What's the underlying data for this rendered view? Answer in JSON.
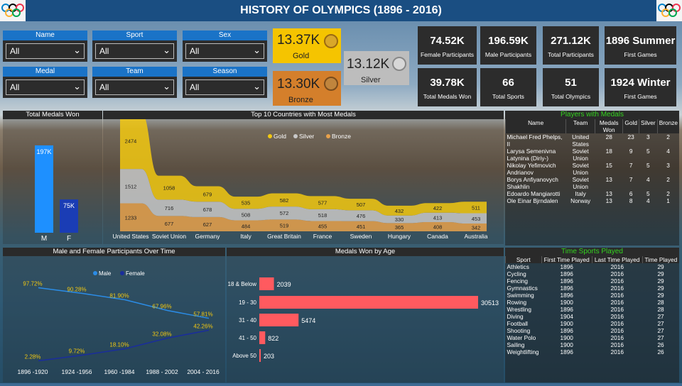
{
  "title": "HISTORY OF OLYMPICS  (1896 - 2016)",
  "slicers": [
    {
      "label": "Name",
      "value": "All"
    },
    {
      "label": "Sport",
      "value": "All"
    },
    {
      "label": "Sex",
      "value": "All"
    },
    {
      "label": "Medal",
      "value": "All"
    },
    {
      "label": "Team",
      "value": "All"
    },
    {
      "label": "Season",
      "value": "All"
    }
  ],
  "medals": {
    "gold_value": "13.37K",
    "gold_label": "Gold",
    "silver_value": "13.12K",
    "silver_label": "Silver",
    "bronze_value": "13.30K",
    "bronze_label": "Bronze"
  },
  "cards": [
    {
      "value": "74.52K",
      "label": "Female Participants"
    },
    {
      "value": "196.59K",
      "label": "Male Participants"
    },
    {
      "value": "271.12K",
      "label": "Total Participants"
    },
    {
      "value": "1896 Summer",
      "label": "First Games"
    },
    {
      "value": "39.78K",
      "label": "Total Medals Won"
    },
    {
      "value": "66",
      "label": "Total Sports"
    },
    {
      "value": "51",
      "label": "Total Olympics"
    },
    {
      "value": "1924 Winter",
      "label": "First Games"
    }
  ],
  "total_medals": {
    "title": "Total Medals Won"
  },
  "top10": {
    "title": "Top 10 Countries with Most Medals",
    "legend": [
      "Gold",
      "Silver",
      "Bronze"
    ]
  },
  "participants": {
    "title": "Male and Female Participants Over Time",
    "legend": [
      "Male",
      "Female"
    ]
  },
  "by_age": {
    "title": "Medals Won by Age"
  },
  "players": {
    "title": "Players with Medals",
    "headers": [
      "Name",
      "Team",
      "Medals Won",
      "Gold",
      "Silver",
      "Bronze"
    ],
    "rows": [
      [
        "Michael Fred Phelps, II",
        "United States",
        "28",
        "23",
        "3",
        "2"
      ],
      [
        "Larysa Semenivna Latynina (Diriy-)",
        "Soviet Union",
        "18",
        "9",
        "5",
        "4"
      ],
      [
        "Nikolay Yefimovich Andrianov",
        "Soviet Union",
        "15",
        "7",
        "5",
        "3"
      ],
      [
        "Borys Anfiyanovych Shakhlin",
        "Soviet Union",
        "13",
        "7",
        "4",
        "2"
      ],
      [
        "Edoardo Mangiarotti",
        "Italy",
        "13",
        "6",
        "5",
        "2"
      ],
      [
        "Ole Einar Bjrndalen",
        "Norway",
        "13",
        "8",
        "4",
        "1"
      ]
    ]
  },
  "sports": {
    "title": "Time Sports Played",
    "headers": [
      "Sport",
      "First Time Played",
      "Last Time Played",
      "Time Played"
    ],
    "rows": [
      [
        "Athletics",
        "1896",
        "2016",
        "29"
      ],
      [
        "Cycling",
        "1896",
        "2016",
        "29"
      ],
      [
        "Fencing",
        "1896",
        "2016",
        "29"
      ],
      [
        "Gymnastics",
        "1896",
        "2016",
        "29"
      ],
      [
        "Swimming",
        "1896",
        "2016",
        "29"
      ],
      [
        "Rowing",
        "1900",
        "2016",
        "28"
      ],
      [
        "Wrestling",
        "1896",
        "2016",
        "28"
      ],
      [
        "Diving",
        "1904",
        "2016",
        "27"
      ],
      [
        "Football",
        "1900",
        "2016",
        "27"
      ],
      [
        "Shooting",
        "1896",
        "2016",
        "27"
      ],
      [
        "Water Polo",
        "1900",
        "2016",
        "27"
      ],
      [
        "Sailing",
        "1900",
        "2016",
        "26"
      ],
      [
        "Weightlifting",
        "1896",
        "2016",
        "26"
      ]
    ]
  },
  "chart_data": [
    {
      "type": "bar",
      "title": "Total Medals Won",
      "categories": [
        "M",
        "F"
      ],
      "values": [
        197000,
        75000
      ],
      "data_labels": [
        "197K",
        "75K"
      ],
      "colors": [
        "#1e90ff",
        "#1a3db5"
      ]
    },
    {
      "type": "area",
      "title": "Top 10 Countries with Most Medals",
      "categories": [
        "United States",
        "Soviet Union",
        "Germany",
        "Italy",
        "Great Britain",
        "France",
        "Sweden",
        "Hungary",
        "Canada",
        "Australia"
      ],
      "series": [
        {
          "name": "Gold",
          "color": "#f2c811",
          "values": [
            2474,
            1058,
            679,
            535,
            582,
            577,
            507,
            432,
            422,
            511
          ]
        },
        {
          "name": "Silver",
          "color": "#c8c8c8",
          "values": [
            1512,
            716,
            678,
            508,
            572,
            518,
            476,
            330,
            413,
            453
          ]
        },
        {
          "name": "Bronze",
          "color": "#e8a14b",
          "values": [
            1233,
            677,
            627,
            484,
            519,
            455,
            451,
            365,
            408,
            342
          ]
        }
      ]
    },
    {
      "type": "line",
      "title": "Male and Female Participants Over Time",
      "categories": [
        "1896 -1920",
        "1924 -1956",
        "1960 -1984",
        "1988 - 2002",
        "2004 - 2016"
      ],
      "series": [
        {
          "name": "Male",
          "color": "#2b8ce6",
          "values": [
            97.72,
            90.28,
            81.9,
            67.96,
            57.81
          ],
          "labels": [
            "97.72%",
            "90.28%",
            "81.90%",
            "67.96%",
            "57.81%"
          ]
        },
        {
          "name": "Female",
          "color": "#1a2d9c",
          "values": [
            2.28,
            9.72,
            18.1,
            32.08,
            42.26
          ],
          "labels": [
            "2.28%",
            "9.72%",
            "18.10%",
            "32.08%",
            "42.26%"
          ]
        }
      ]
    },
    {
      "type": "bar",
      "title": "Medals Won by Age",
      "categories": [
        "18 & Below",
        "19 - 30",
        "31 - 40",
        "41 - 50",
        "Above 50"
      ],
      "values": [
        2039,
        30513,
        5474,
        822,
        203
      ],
      "color": "#ff5a5f"
    }
  ]
}
